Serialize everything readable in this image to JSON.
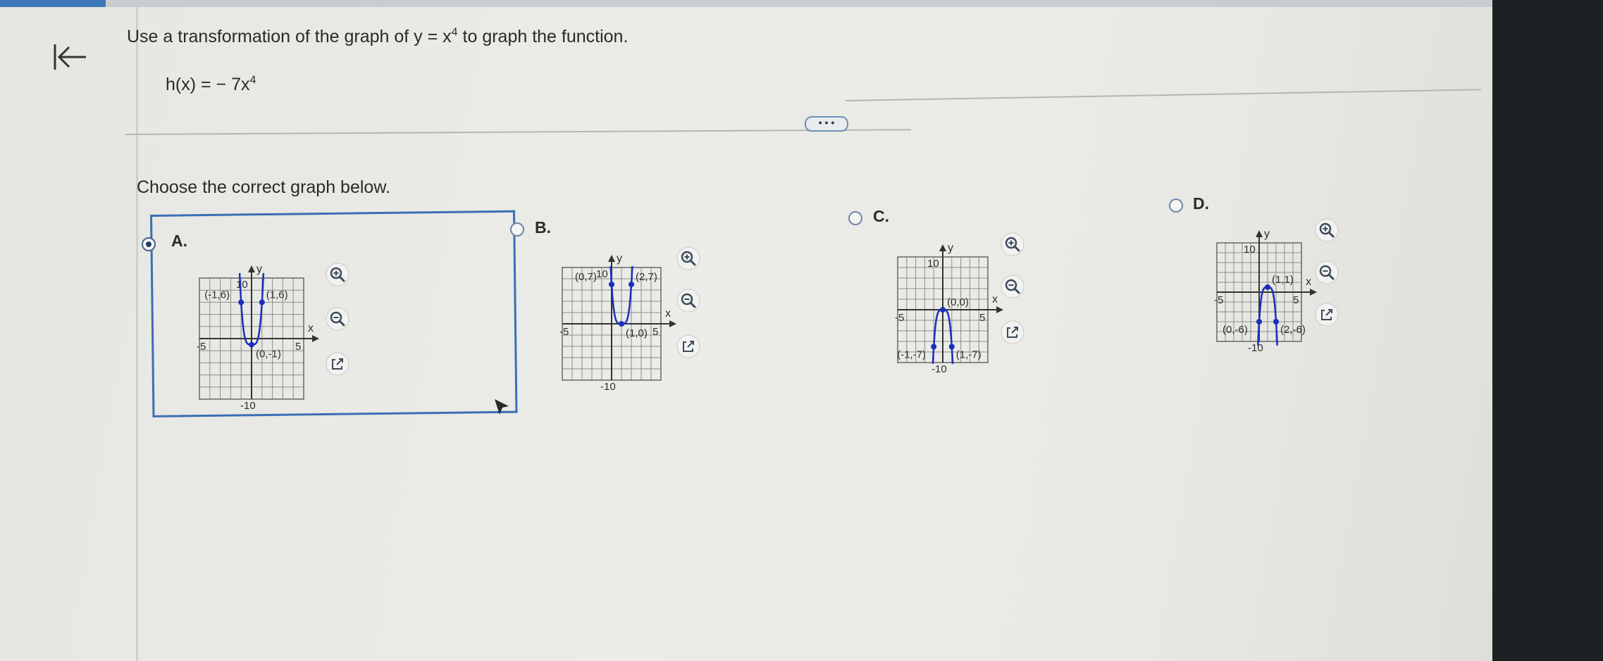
{
  "question": {
    "prefix": "Use a transformation of the graph of y = x",
    "exponent": "4",
    "suffix": " to graph the function."
  },
  "function": {
    "lhs": "h(x) = − 7x",
    "exponent": "4"
  },
  "more_button": "• • •",
  "instruction": "Choose the correct graph below.",
  "options": [
    {
      "label": "A.",
      "selected": true,
      "axis_labels": {
        "y": "y",
        "x": "x",
        "ymax": "10",
        "ymin": "-10",
        "xmin": "-5",
        "xmax": "5"
      },
      "points": [
        {
          "label": "(-1,6)",
          "x": -1,
          "y": 6
        },
        {
          "label": "(1,6)",
          "x": 1,
          "y": 6
        },
        {
          "label": "(0,-1)",
          "x": 0,
          "y": -1
        }
      ]
    },
    {
      "label": "B.",
      "selected": false,
      "axis_labels": {
        "y": "y",
        "x": "x",
        "ymax": "10",
        "ymin": "-10",
        "xmin": "-5",
        "xmax": "5"
      },
      "points": [
        {
          "label": "(0,7)",
          "x": 0,
          "y": 7
        },
        {
          "label": "(2,7)",
          "x": 2,
          "y": 7
        },
        {
          "label": "(1,0)",
          "x": 1,
          "y": 0
        }
      ]
    },
    {
      "label": "C.",
      "selected": false,
      "axis_labels": {
        "y": "y",
        "x": "x",
        "ymax": "10",
        "ymin": "-10",
        "xmin": "-5",
        "xmax": "5"
      },
      "points": [
        {
          "label": "(0,0)",
          "x": 0,
          "y": 0
        },
        {
          "label": "(-1,-7)",
          "x": -1,
          "y": -7
        },
        {
          "label": "(1,-7)",
          "x": 1,
          "y": -7
        }
      ]
    },
    {
      "label": "D.",
      "selected": false,
      "axis_labels": {
        "y": "y",
        "x": "x",
        "ymax": "10",
        "ymin": "-10",
        "xmin": "-5",
        "xmax": "5"
      },
      "points": [
        {
          "label": "(1,1)",
          "x": 1,
          "y": 1
        },
        {
          "label": "(0,-6)",
          "x": 0,
          "y": -6
        },
        {
          "label": "(2,-6)",
          "x": 2,
          "y": -6
        }
      ]
    }
  ],
  "tools": [
    "zoom-in",
    "zoom-out",
    "open-new-window"
  ],
  "colors": {
    "curve": "#1c2fb8",
    "grid": "#8c8c8c",
    "selection": "#3c6eb4"
  }
}
